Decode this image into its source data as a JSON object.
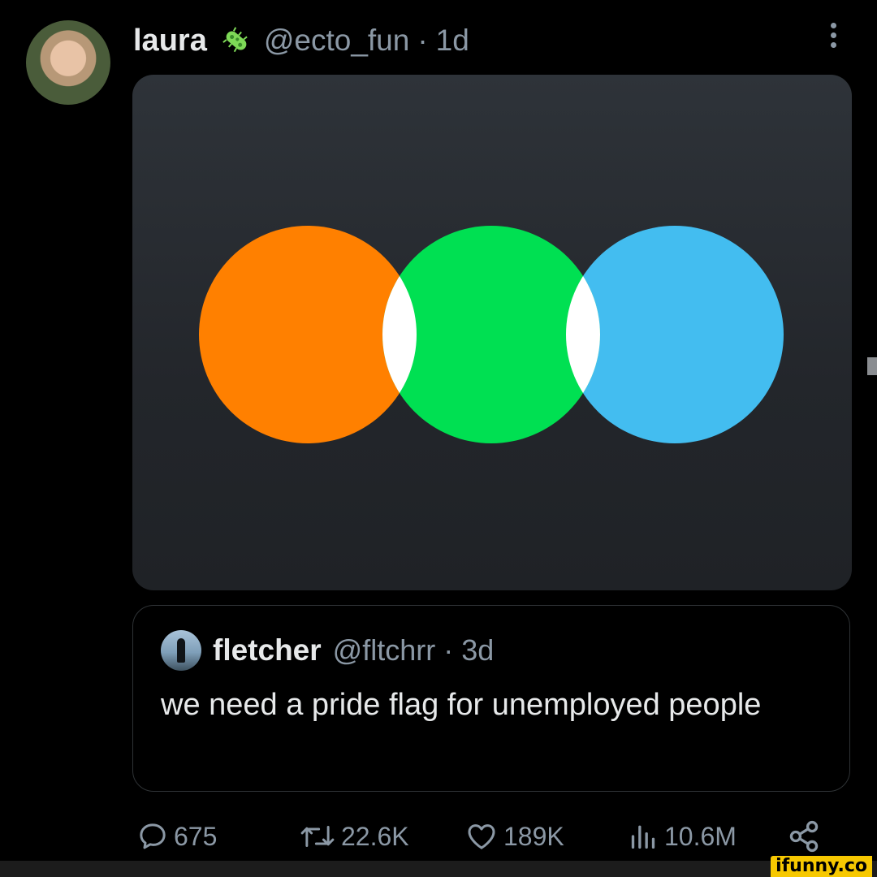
{
  "post": {
    "author_name": "laura",
    "author_handle": "@ecto_fun",
    "separator": "·",
    "age": "1d",
    "badge_icon": "bacteria-emoji",
    "more_icon": "more-vertical-icon",
    "media_description": "three overlapping circles: orange, green, blue with white overlaps",
    "media_colors": [
      "#ff8000",
      "#00e052",
      "#43bdf0"
    ]
  },
  "quoted": {
    "author_name": "fletcher",
    "author_handle": "@fltchrr",
    "separator": "·",
    "age": "3d",
    "text": "we need a pride flag for unemployed people"
  },
  "actions": {
    "replies": "675",
    "reposts": "22.6K",
    "likes": "189K",
    "views": "10.6M"
  },
  "watermark": "ifunny.co"
}
